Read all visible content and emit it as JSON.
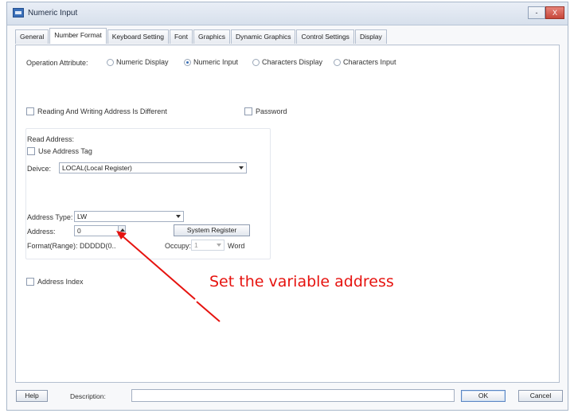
{
  "window": {
    "title": "Numeric Input",
    "controls": {
      "minimize": "-",
      "close": "X"
    }
  },
  "tabs": [
    {
      "label": "General",
      "active": false
    },
    {
      "label": "Number Format",
      "active": true
    },
    {
      "label": "Keyboard Setting",
      "active": false
    },
    {
      "label": "Font",
      "active": false
    },
    {
      "label": "Graphics",
      "active": false
    },
    {
      "label": "Dynamic Graphics",
      "active": false
    },
    {
      "label": "Control Settings",
      "active": false
    },
    {
      "label": "Display",
      "active": false
    }
  ],
  "operation": {
    "label": "Operation Attribute:",
    "options": [
      {
        "label": "Numeric Display",
        "selected": false
      },
      {
        "label": "Numeric Input",
        "selected": true
      },
      {
        "label": "Characters Display",
        "selected": false
      },
      {
        "label": "Characters Input",
        "selected": false
      }
    ]
  },
  "rw_diff_label": "Reading And Writing Address Is Different",
  "password_label": "Password",
  "read_address": {
    "heading": "Read Address:",
    "use_tag_label": "Use Address Tag",
    "device_label": "Deivce:",
    "device_value": "LOCAL(Local Register)",
    "address_type_label": "Address Type:",
    "address_type_value": "LW",
    "address_label": "Address:",
    "address_value": "0",
    "system_register_button": "System Register",
    "format_label": "Format(Range): DDDDD(0..",
    "occupy_label": "Occupy:",
    "occupy_value": "1",
    "occupy_unit": "Word"
  },
  "address_index_label": "Address Index",
  "annotation": {
    "text": "Set the variable address",
    "color": "#e6130f"
  },
  "footer": {
    "help_button": "Help",
    "description_label": "Description:",
    "ok_button": "OK",
    "cancel_button": "Cancel"
  }
}
